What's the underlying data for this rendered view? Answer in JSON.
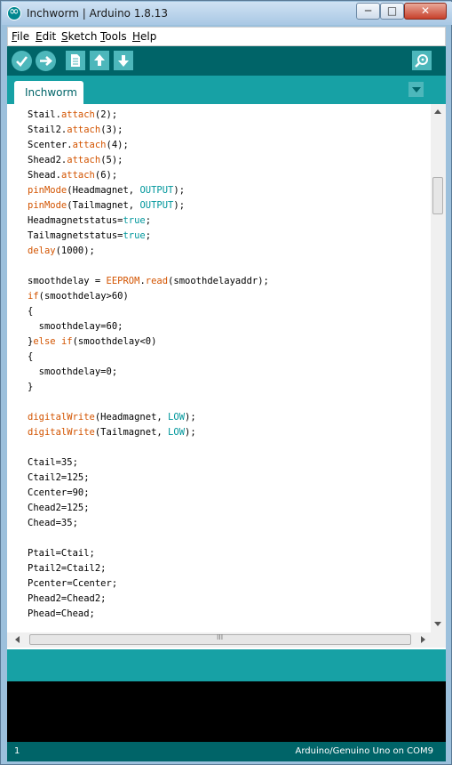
{
  "window": {
    "title": "Inchworm | Arduino 1.8.13",
    "minimize": "─",
    "maximize": "□",
    "close": "✕"
  },
  "menu": {
    "file": {
      "u": "F",
      "rest": "ile"
    },
    "edit": {
      "u": "E",
      "rest": "dit"
    },
    "sketch": {
      "u": "S",
      "rest": "ketch"
    },
    "tools": {
      "u": "T",
      "rest": "ools"
    },
    "help": {
      "u": "H",
      "rest": "elp"
    }
  },
  "toolbar": {
    "icons": [
      "verify-icon",
      "upload-icon",
      "new-icon",
      "open-icon",
      "save-icon",
      "serial-monitor-icon"
    ]
  },
  "tabs": [
    {
      "label": "Inchworm"
    }
  ],
  "code_lines": [
    [
      {
        "t": "Stail."
      },
      {
        "t": "attach",
        "c": "o"
      },
      {
        "t": "(2);"
      }
    ],
    [
      {
        "t": "Stail2."
      },
      {
        "t": "attach",
        "c": "o"
      },
      {
        "t": "(3);"
      }
    ],
    [
      {
        "t": "Scenter."
      },
      {
        "t": "attach",
        "c": "o"
      },
      {
        "t": "(4);"
      }
    ],
    [
      {
        "t": "Shead2."
      },
      {
        "t": "attach",
        "c": "o"
      },
      {
        "t": "(5);"
      }
    ],
    [
      {
        "t": "Shead."
      },
      {
        "t": "attach",
        "c": "o"
      },
      {
        "t": "(6);"
      }
    ],
    [
      {
        "t": "pinMode",
        "c": "o"
      },
      {
        "t": "(Headmagnet, "
      },
      {
        "t": "OUTPUT",
        "c": "t"
      },
      {
        "t": ");"
      }
    ],
    [
      {
        "t": "pinMode",
        "c": "o"
      },
      {
        "t": "(Tailmagnet, "
      },
      {
        "t": "OUTPUT",
        "c": "t"
      },
      {
        "t": ");"
      }
    ],
    [
      {
        "t": "Headmagnetstatus="
      },
      {
        "t": "true",
        "c": "t"
      },
      {
        "t": ";"
      }
    ],
    [
      {
        "t": "Tailmagnetstatus="
      },
      {
        "t": "true",
        "c": "t"
      },
      {
        "t": ";"
      }
    ],
    [
      {
        "t": "delay",
        "c": "o"
      },
      {
        "t": "(1000);"
      }
    ],
    [],
    [
      {
        "t": "smoothdelay = "
      },
      {
        "t": "EEPROM",
        "c": "o"
      },
      {
        "t": "."
      },
      {
        "t": "read",
        "c": "o"
      },
      {
        "t": "(smoothdelayaddr);"
      }
    ],
    [
      {
        "t": "if",
        "c": "o"
      },
      {
        "t": "(smoothdelay>60)"
      }
    ],
    [
      {
        "t": "{"
      }
    ],
    [
      {
        "t": "  smoothdelay=60;"
      }
    ],
    [
      {
        "t": "}"
      },
      {
        "t": "else",
        "c": "o"
      },
      {
        "t": " "
      },
      {
        "t": "if",
        "c": "o"
      },
      {
        "t": "(smoothdelay<0)"
      }
    ],
    [
      {
        "t": "{"
      }
    ],
    [
      {
        "t": "  smoothdelay=0;"
      }
    ],
    [
      {
        "t": "}"
      }
    ],
    [],
    [
      {
        "t": "digitalWrite",
        "c": "o"
      },
      {
        "t": "(Headmagnet, "
      },
      {
        "t": "LOW",
        "c": "t"
      },
      {
        "t": ");"
      }
    ],
    [
      {
        "t": "digitalWrite",
        "c": "o"
      },
      {
        "t": "(Tailmagnet, "
      },
      {
        "t": "LOW",
        "c": "t"
      },
      {
        "t": ");"
      }
    ],
    [],
    [
      {
        "t": "Ctail=35;"
      }
    ],
    [
      {
        "t": "Ctail2=125;"
      }
    ],
    [
      {
        "t": "Ccenter=90;"
      }
    ],
    [
      {
        "t": "Chead2=125;"
      }
    ],
    [
      {
        "t": "Chead=35;"
      }
    ],
    [],
    [
      {
        "t": "Ptail=Ctail;"
      }
    ],
    [
      {
        "t": "Ptail2=Ctail2;"
      }
    ],
    [
      {
        "t": "Pcenter=Ccenter;"
      }
    ],
    [
      {
        "t": "Phead2=Chead2;"
      }
    ],
    [
      {
        "t": "Phead=Chead;"
      }
    ]
  ],
  "hscroll_grip": "III",
  "status": {
    "line": "1",
    "board": "Arduino/Genuino Uno on COM9"
  },
  "colors": {
    "toolbar": "#006468",
    "tabbar": "#17a1a5",
    "keyword_orange": "#d35400",
    "keyword_teal": "#00979c",
    "console": "#000000"
  }
}
